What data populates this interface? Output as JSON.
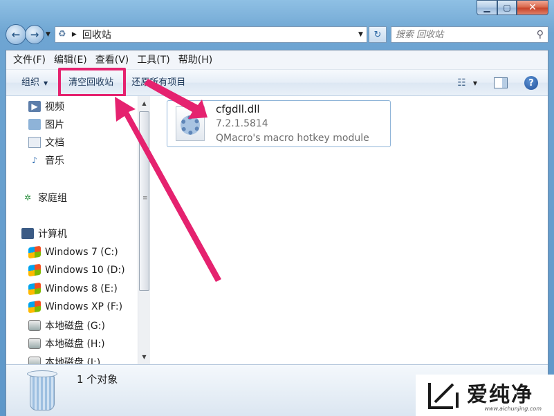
{
  "window": {
    "minimize_icon": "minimize-icon",
    "maximize_icon": "maximize-icon",
    "close_icon": "close-icon"
  },
  "address": {
    "path": "回收站",
    "search_placeholder": "搜索 回收站"
  },
  "menu": [
    {
      "label": "文件(F)"
    },
    {
      "label": "编辑(E)"
    },
    {
      "label": "查看(V)"
    },
    {
      "label": "工具(T)"
    },
    {
      "label": "帮助(H)"
    }
  ],
  "toolbar": {
    "organize": "组织",
    "empty_recycle_bin": "清空回收站",
    "restore_all": "还原所有项目",
    "help_label": "?"
  },
  "nav": {
    "libraries": [
      {
        "label": "视频",
        "icon": "video-icon"
      },
      {
        "label": "图片",
        "icon": "pictures-icon"
      },
      {
        "label": "文档",
        "icon": "documents-icon"
      },
      {
        "label": "音乐",
        "icon": "music-icon"
      }
    ],
    "homegroup": {
      "label": "家庭组",
      "icon": "homegroup-icon"
    },
    "computer": {
      "label": "计算机",
      "icon": "computer-icon"
    },
    "drives": [
      {
        "label": "Windows 7 (C:)",
        "icon": "windows-drive-icon"
      },
      {
        "label": "Windows 10 (D:)",
        "icon": "windows-drive-icon"
      },
      {
        "label": "Windows 8 (E:)",
        "icon": "windows-drive-icon"
      },
      {
        "label": "Windows XP (F:)",
        "icon": "windows-drive-icon"
      },
      {
        "label": "本地磁盘 (G:)",
        "icon": "local-disk-icon"
      },
      {
        "label": "本地磁盘 (H:)",
        "icon": "local-disk-icon"
      },
      {
        "label": "本地磁盘 (I:)",
        "icon": "local-disk-icon"
      }
    ]
  },
  "file": {
    "name": "cfgdll.dll",
    "version": "7.2.1.5814",
    "description": "QMacro's macro hotkey module",
    "icon": "dll-gear-icon"
  },
  "status": {
    "count": "1 个对象",
    "icon": "recycle-bin-icon"
  },
  "watermark": {
    "brand": "爱纯净",
    "url": "www.aichunjing.com"
  },
  "colors": {
    "highlight": "#e5226f",
    "window_frame": "#6ea5d2"
  }
}
